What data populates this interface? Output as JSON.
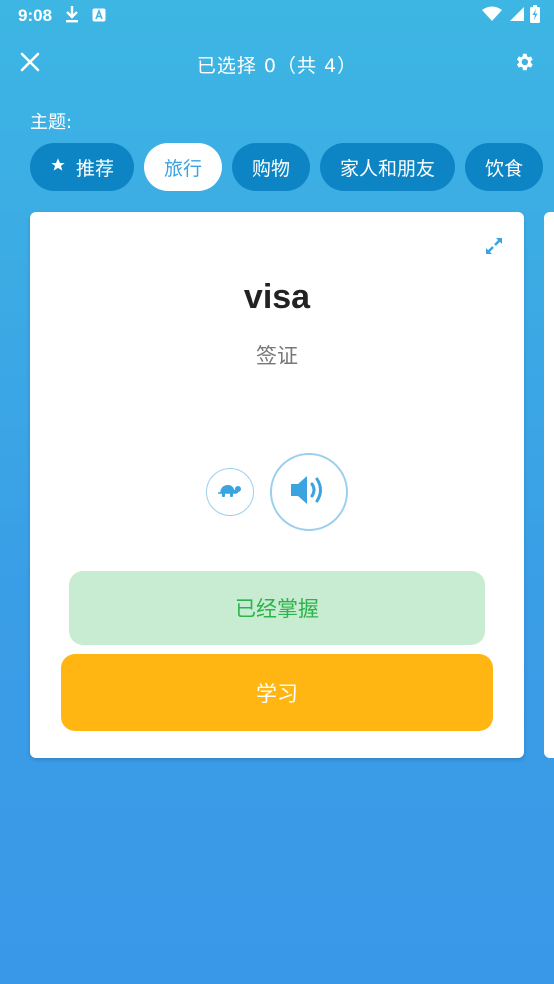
{
  "status_bar": {
    "time": "9:08"
  },
  "app_bar": {
    "title": "已选择 0（共 4）"
  },
  "topics": {
    "label": "主题:",
    "chips": [
      {
        "label": "推荐",
        "icon": "star-icon",
        "active": false
      },
      {
        "label": "旅行",
        "active": true
      },
      {
        "label": "购物",
        "active": false
      },
      {
        "label": "家人和朋友",
        "active": false
      },
      {
        "label": "饮食",
        "active": false
      }
    ]
  },
  "card": {
    "word": "visa",
    "translation": "签证",
    "mastered_label": "已经掌握",
    "learn_label": "学习"
  },
  "colors": {
    "accent": "#3aa3e0",
    "chip_bg": "#0d85c4",
    "mastered_bg": "#c8ecd1",
    "mastered_text": "#2bb44a",
    "learn_bg": "#ffb612"
  }
}
